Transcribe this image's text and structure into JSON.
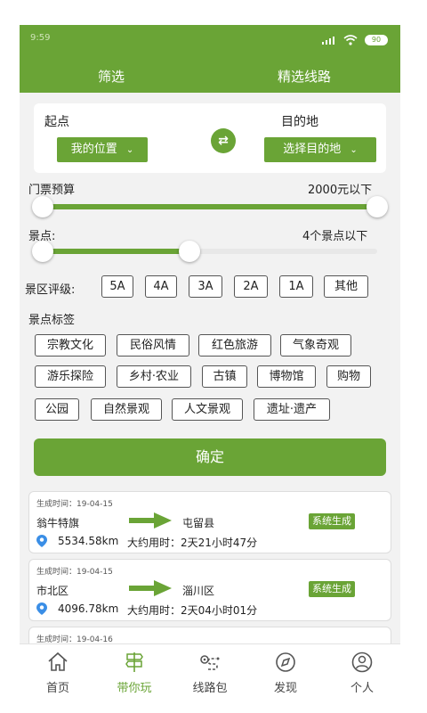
{
  "status_bar": {
    "carrier": "9:59",
    "battery": "90"
  },
  "header": {
    "tab_filter": "筛选",
    "tab_routes": "精选线路"
  },
  "od": {
    "origin_label": "起点",
    "origin_value": "我的位置",
    "dest_label": "目的地",
    "dest_value": "选择目的地",
    "swap_icon": "swap-arrows"
  },
  "budget": {
    "label": "门票预算",
    "value": "2000元以下",
    "level": 1.0
  },
  "spots": {
    "label": "景点:",
    "value": "4个景点以下",
    "level": 0.44
  },
  "rating": {
    "label": "景区评级:",
    "options": [
      "5A",
      "4A",
      "3A",
      "2A",
      "1A",
      "其他"
    ]
  },
  "tags": {
    "label": "景点标签",
    "rows": [
      [
        "宗教文化",
        "民俗风情",
        "红色旅游",
        "气象奇观"
      ],
      [
        "游乐探险",
        "乡村·农业",
        "古镇",
        "博物馆",
        "购物"
      ],
      [
        "公园",
        "自然景观",
        "人文景观",
        "遗址·遗产"
      ]
    ]
  },
  "confirm_label": "确定",
  "routes": [
    {
      "time": "生成时间：19-04-15",
      "from": "翁牛特旗",
      "to": "屯留县",
      "badge": "系统生成",
      "distance": "5534.58km",
      "duration": "大约用时：2天21小时47分"
    },
    {
      "time": "生成时间：19-04-15",
      "from": "市北区",
      "to": "淄川区",
      "badge": "系统生成",
      "distance": "4096.78km",
      "duration": "大约用时：2天04小时01分"
    },
    {
      "time": "生成时间：19-04-16"
    }
  ],
  "nav": [
    {
      "label": "首页",
      "icon": "home-icon"
    },
    {
      "label": "带你玩",
      "icon": "signpost-icon",
      "active": true
    },
    {
      "label": "线路包",
      "icon": "route-icon"
    },
    {
      "label": "发现",
      "icon": "compass-icon"
    },
    {
      "label": "个人",
      "icon": "user-icon"
    }
  ],
  "colors": {
    "accent": "#6aa436",
    "background": "#f2f2f2"
  }
}
